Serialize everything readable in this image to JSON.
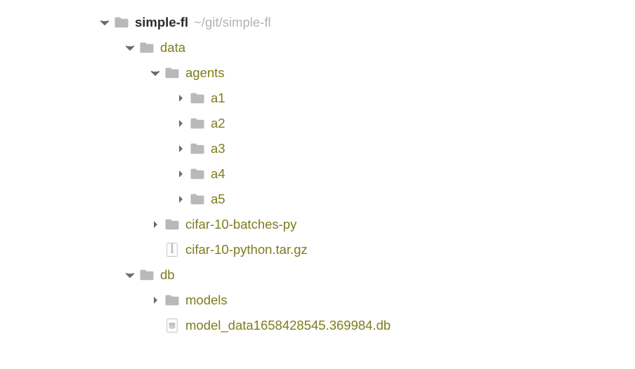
{
  "tree": {
    "root": {
      "label": "simple-fl",
      "path": "~/git/simple-fl"
    },
    "data": {
      "label": "data",
      "agents": {
        "label": "agents",
        "children": [
          {
            "label": "a1"
          },
          {
            "label": "a2"
          },
          {
            "label": "a3"
          },
          {
            "label": "a4"
          },
          {
            "label": "a5"
          }
        ]
      },
      "cifar_folder": {
        "label": "cifar-10-batches-py"
      },
      "cifar_file": {
        "label": "cifar-10-python.tar.gz"
      }
    },
    "db": {
      "label": "db",
      "models": {
        "label": "models"
      },
      "dbfile": {
        "label": "model_data1658428545.369984.db"
      }
    }
  }
}
